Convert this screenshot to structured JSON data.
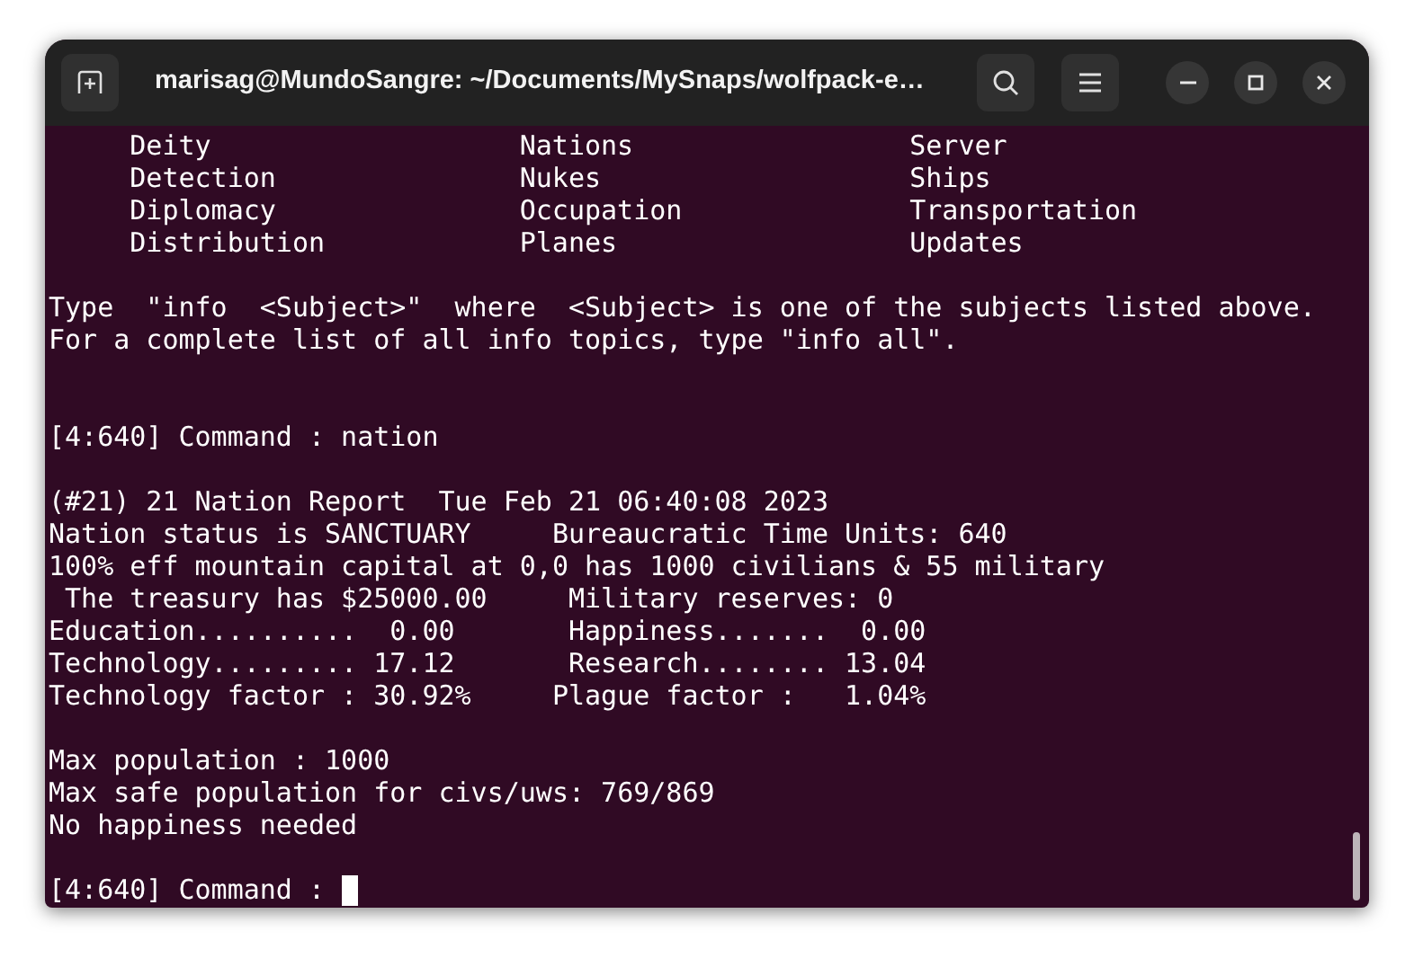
{
  "window": {
    "title": "marisag@MundoSangre: ~/Documents/MySnaps/wolfpack-e…"
  },
  "terminal": {
    "topics": [
      [
        "Deity",
        "Nations",
        "Server"
      ],
      [
        "Detection",
        "Nukes",
        "Ships"
      ],
      [
        "Diplomacy",
        "Occupation",
        "Transportation"
      ],
      [
        "Distribution",
        "Planes",
        "Updates"
      ]
    ],
    "blocks": [
      {
        "kind": "help",
        "lines": [
          "Type  \"info  <Subject>\"  where  <Subject> is one of the subjects listed above.",
          "For a complete list of all info topics, type \"info all\"."
        ]
      },
      {
        "kind": "command",
        "lines": [
          "[4:640] Command : nation"
        ]
      },
      {
        "kind": "report",
        "lines": [
          "(#21) 21 Nation Report  Tue Feb 21 06:40:08 2023",
          "Nation status is SANCTUARY     Bureaucratic Time Units: 640",
          "100% eff mountain capital at 0,0 has 1000 civilians & 55 military",
          " The treasury has $25000.00     Military reserves: 0",
          "Education..........  0.00       Happiness.......  0.00",
          "Technology......... 17.12       Research........ 13.04",
          "Technology factor : 30.92%     Plague factor :   1.04%"
        ]
      },
      {
        "kind": "report",
        "lines": [
          "Max population : 1000",
          "Max safe population for civs/uws: 769/869",
          "No happiness needed"
        ]
      }
    ],
    "prompt": "[4:640] Command :"
  }
}
